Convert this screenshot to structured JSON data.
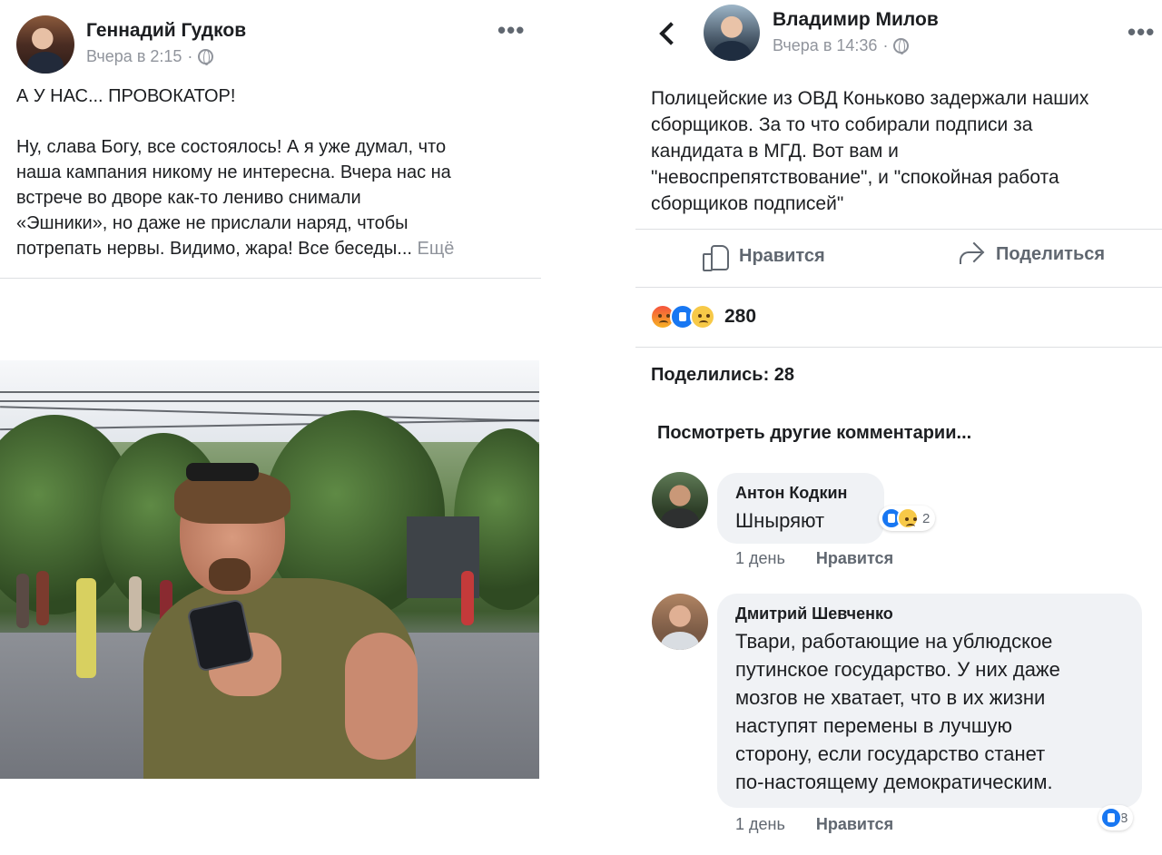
{
  "left_post": {
    "author": "Геннадий Гудков",
    "time": "Вчера в 2:15",
    "separator": "·",
    "more_icon": "more-horizontal-icon",
    "title": "А У НАС... ПРОВОКАТОР!",
    "body": "Ну, слава Богу, все состоялось! А я уже думал, что\nнаша кампания никому не интересна. Вчера нас на\nвстрече во дворе как-то лениво снимали\n«Эшники», но даже не прислали наряд, чтобы\nпотрепать нервы. Видимо, жара! Все беседы...",
    "see_more": "Ещё"
  },
  "right_post": {
    "author": "Владимир Милов",
    "time": "Вчера в 14:36",
    "separator": "·",
    "body": "Полицейские из ОВД Коньково задержали наших\nсборщиков. За то что собирали подписи за\nкандидата в МГД. Вот вам и\n\"невоспрепятствование\", и \"спокойная работа\nсборщиков подписей\"",
    "actions": {
      "like": "Нравится",
      "share": "Поделиться"
    },
    "reactions": {
      "icons": [
        "angry",
        "like",
        "sad"
      ],
      "count": "280"
    },
    "shares": "Поделились: 28",
    "see_more_comments": "Посмотреть другие комментарии..."
  },
  "comments": [
    {
      "author": "Антон Кодкин",
      "text": "Шныряют",
      "time": "1 день",
      "like": "Нравится",
      "reactions": [
        "like",
        "haha"
      ],
      "reaction_count": "2"
    },
    {
      "author": "Дмитрий Шевченко",
      "text": "Твари, работающие на ублюдское\nпутинское государство. У них даже\nмозгов не хватает, что в их жизни\nнаступят перемены в лучшую\nсторону, если государство станет\nпо-настоящему демократическим.",
      "time": "1 день",
      "like": "Нравится",
      "reactions": [
        "like"
      ],
      "reaction_count": "8"
    }
  ],
  "colors": {
    "text": "#1c1e21",
    "secondary": "#606770",
    "meta": "#90949c",
    "bubble": "#f0f2f5",
    "like_blue": "#1877f2"
  }
}
